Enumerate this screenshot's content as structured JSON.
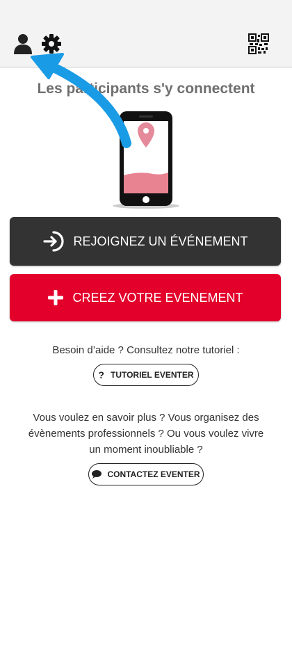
{
  "topbar": {
    "profile_icon": "user-icon",
    "settings_icon": "gear-icon",
    "qr_icon": "qr-code-icon"
  },
  "main": {
    "headline": "Les participants s'y connectent",
    "join_button_label": "REJOIGNEZ UN ÉVÉNEMENT",
    "create_button_label": "CREEZ VOTRE EVENEMENT",
    "help_text": "Besoin d’aide ? Consultez notre tutoriel :",
    "tutorial_button_label": "TUTORIEL EVENTER",
    "more_text": "Vous voulez en savoir plus ? Vous organisez des évènements professionnels ? Ou vous voulez vivre un moment inoubliable ?",
    "contact_button_label": "CONTACTEZ EVENTER"
  },
  "colors": {
    "join_bg": "#333333",
    "create_bg": "#e3002a",
    "overlay_arrow": "#1a9be6"
  }
}
